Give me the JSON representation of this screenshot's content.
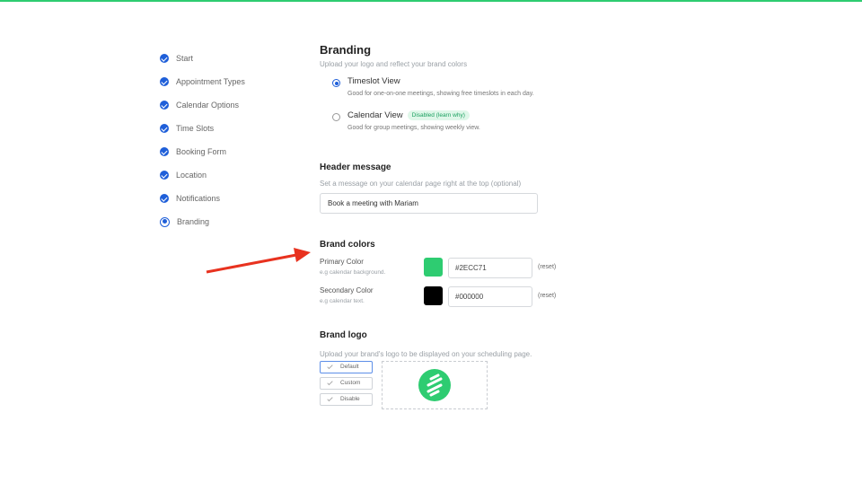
{
  "steps": [
    {
      "label": "Start",
      "state": "done"
    },
    {
      "label": "Appointment Types",
      "state": "done"
    },
    {
      "label": "Calendar Options",
      "state": "done"
    },
    {
      "label": "Time Slots",
      "state": "done"
    },
    {
      "label": "Booking Form",
      "state": "done"
    },
    {
      "label": "Location",
      "state": "done"
    },
    {
      "label": "Notifications",
      "state": "done"
    },
    {
      "label": "Branding",
      "state": "current"
    }
  ],
  "branding": {
    "title": "Branding",
    "subtitle": "Upload your logo and reflect your brand colors",
    "options": [
      {
        "title": "Timeslot View",
        "desc": "Good for one-on-one meetings, showing free timeslots in each day.",
        "selected": true
      },
      {
        "title": "Calendar View",
        "badge": "Disabled (learn why)",
        "desc": "Good for group meetings, showing weekly view.",
        "selected": false
      }
    ]
  },
  "header_message": {
    "title": "Header message",
    "subtitle": "Set a message on your calendar page right at the top (optional)",
    "value": "Book a meeting with Mariam"
  },
  "brand_colors": {
    "title": "Brand colors",
    "primary": {
      "label": "Primary Color",
      "hint": "e.g calendar background.",
      "value": "#2ECC71",
      "reset": "(reset)",
      "swatch": "#2ecc71"
    },
    "secondary": {
      "label": "Secondary Color",
      "hint": "e.g calendar text.",
      "value": "#000000",
      "reset": "(reset)",
      "swatch": "#000000"
    }
  },
  "brand_logo": {
    "title": "Brand logo",
    "subtitle": "Upload your brand's logo to be displayed on your scheduling page.",
    "choices": [
      {
        "label": "Default",
        "selected": true
      },
      {
        "label": "Custom",
        "selected": false
      },
      {
        "label": "Disable",
        "selected": false
      }
    ]
  },
  "colors": {
    "accent": "#2ecc71",
    "step": "#1f5fd9",
    "arrow": "#e8321f"
  }
}
